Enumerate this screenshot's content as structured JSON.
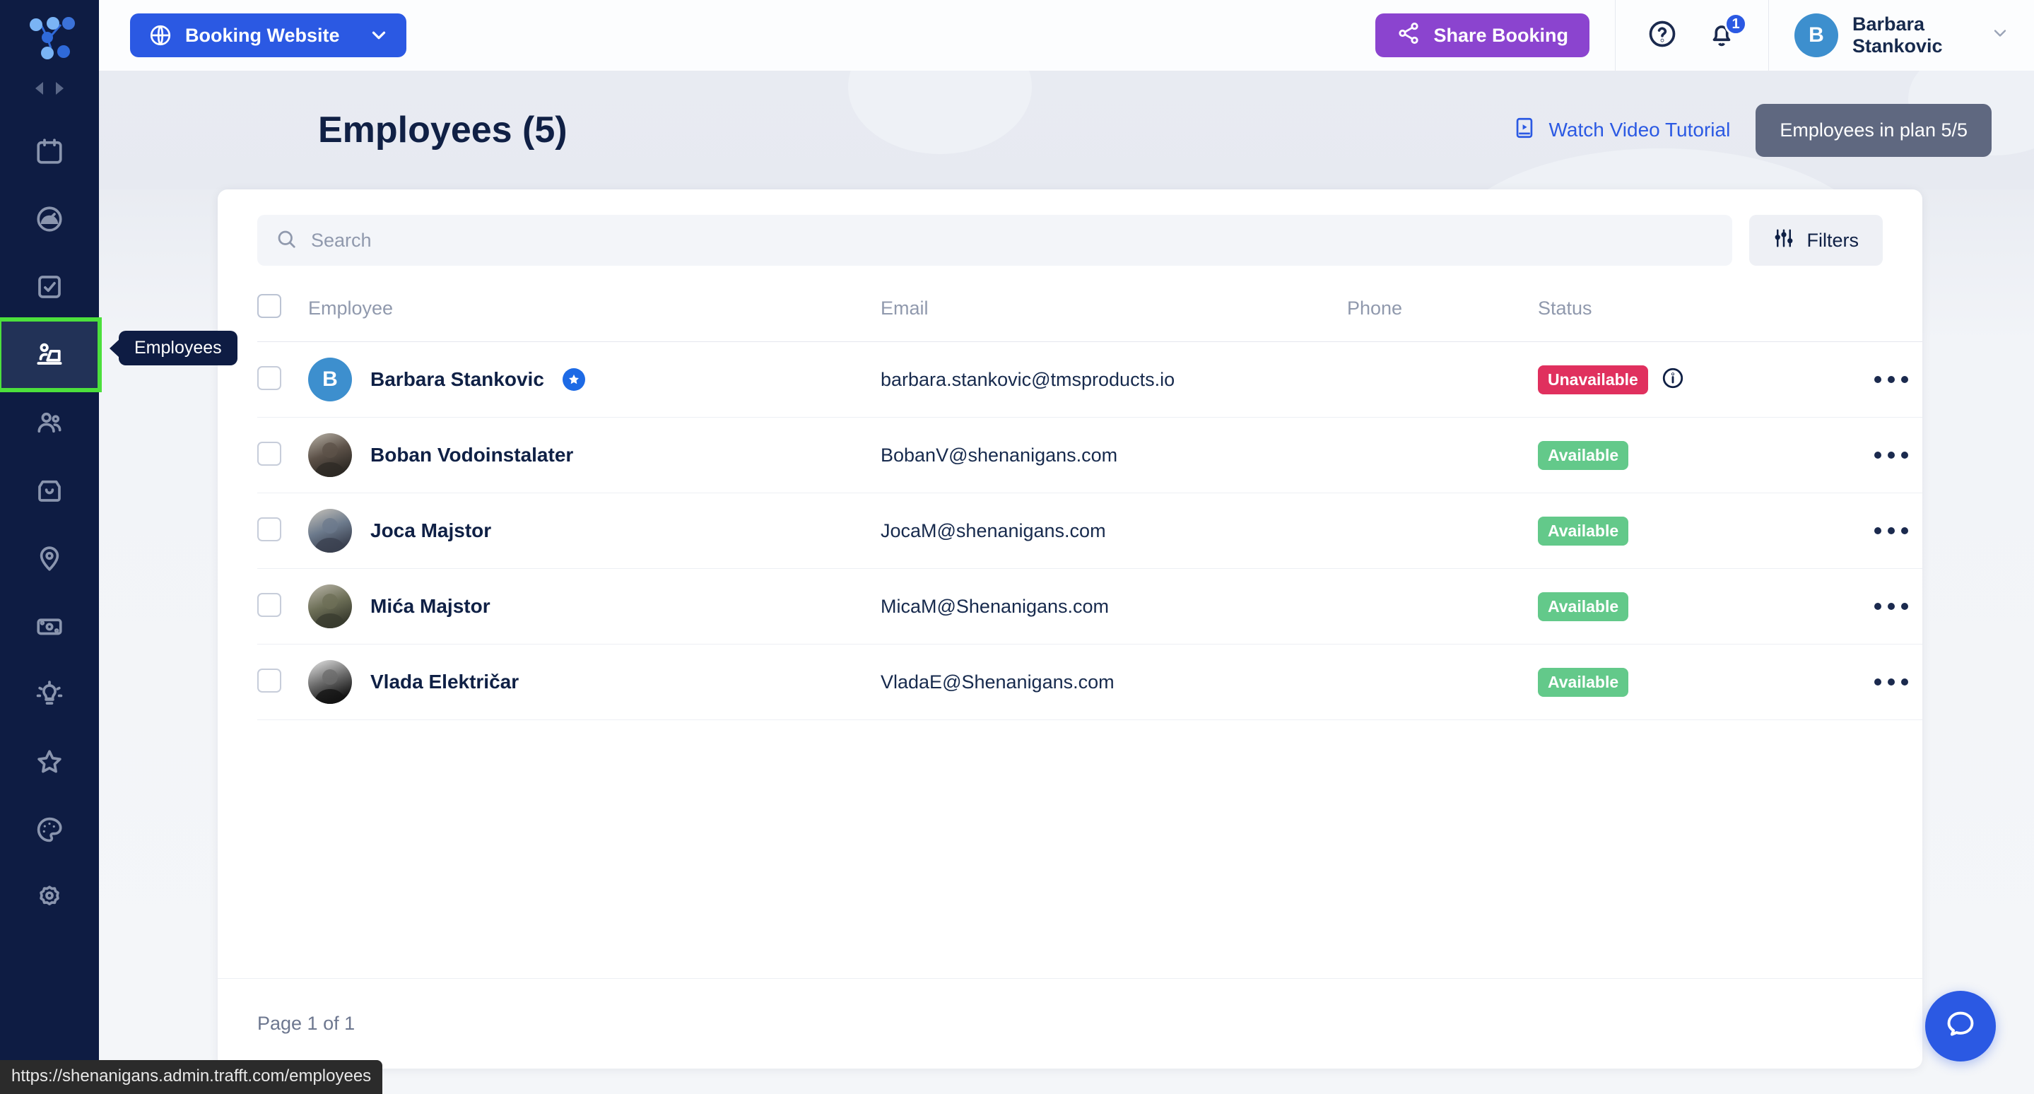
{
  "brand": {
    "logo_name": "trafft-logo",
    "accent": "#2B59E3",
    "sidebar_bg": "#0e1c43"
  },
  "topbar": {
    "booking_button": "Booking Website",
    "share_button": "Share Booking",
    "notifications_count": "1",
    "user_name": "Barbara Stankovic",
    "user_initial": "B"
  },
  "sidebar": {
    "items": [
      {
        "name": "calendar",
        "label": "Calendar",
        "active": false
      },
      {
        "name": "dashboard",
        "label": "Dashboard",
        "active": false
      },
      {
        "name": "bookings",
        "label": "Bookings",
        "active": false
      },
      {
        "name": "employees",
        "label": "Employees",
        "active": true
      },
      {
        "name": "customers",
        "label": "Customers",
        "active": false
      },
      {
        "name": "services",
        "label": "Services",
        "active": false
      },
      {
        "name": "locations",
        "label": "Locations",
        "active": false
      },
      {
        "name": "finance",
        "label": "Finance",
        "active": false
      },
      {
        "name": "features",
        "label": "Features",
        "active": false
      },
      {
        "name": "favorites",
        "label": "Favorites",
        "active": false
      }
    ],
    "bottom_items": [
      {
        "name": "customize",
        "label": "Customize"
      },
      {
        "name": "settings",
        "label": "Settings"
      }
    ],
    "tooltip": "Employees"
  },
  "page": {
    "title": "Employees (5)",
    "watch_video_label": "Watch Video Tutorial",
    "plan_badge": "Employees in plan 5/5"
  },
  "search": {
    "placeholder": "Search",
    "value": ""
  },
  "filters_label": "Filters",
  "table": {
    "columns": [
      "Employee",
      "Email",
      "Phone",
      "Status"
    ],
    "rows": [
      {
        "name": "Barbara Stankovic",
        "email": "barbara.stankovic@tmsproducts.io",
        "phone": "",
        "status": "Unavailable",
        "status_kind": "unavailable",
        "has_info_icon": true,
        "avatar_kind": "initial",
        "avatar_initial": "B",
        "is_owner": true
      },
      {
        "name": "Boban Vodoinstalater",
        "email": "BobanV@shenanigans.com",
        "phone": "",
        "status": "Available",
        "status_kind": "available",
        "has_info_icon": false,
        "avatar_kind": "photo",
        "avatar_initial": "",
        "is_owner": false
      },
      {
        "name": "Joca Majstor",
        "email": "JocaM@shenanigans.com",
        "phone": "",
        "status": "Available",
        "status_kind": "available",
        "has_info_icon": false,
        "avatar_kind": "photo",
        "avatar_initial": "",
        "is_owner": false
      },
      {
        "name": "Mića Majstor",
        "email": "MicaM@Shenanigans.com",
        "phone": "",
        "status": "Available",
        "status_kind": "available",
        "has_info_icon": false,
        "avatar_kind": "photo",
        "avatar_initial": "",
        "is_owner": false
      },
      {
        "name": "Vlada Električar",
        "email": "VladaE@Shenanigans.com",
        "phone": "",
        "status": "Available",
        "status_kind": "available",
        "has_info_icon": false,
        "avatar_kind": "photo",
        "avatar_initial": "",
        "is_owner": false
      }
    ]
  },
  "footer": {
    "page_info": "Page 1 of 1"
  },
  "status_bar_url": "https://shenanigans.admin.trafft.com/employees",
  "colors": {
    "unavailable": "#e0305e",
    "available": "#63c98a",
    "primary": "#2B59E3",
    "share": "#8b44cf",
    "plan_badge": "#5f6880",
    "highlight_outline": "#4ce03c"
  }
}
